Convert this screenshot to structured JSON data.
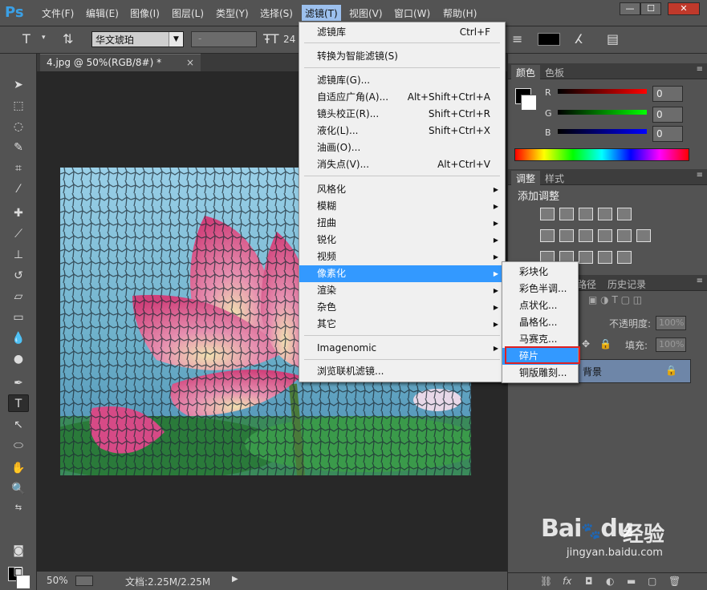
{
  "app": {
    "logo": "Ps"
  },
  "menubar": {
    "items": [
      "文件(F)",
      "编辑(E)",
      "图像(I)",
      "图层(L)",
      "类型(Y)",
      "选择(S)",
      "滤镜(T)",
      "视图(V)",
      "窗口(W)",
      "帮助(H)"
    ],
    "window_buttons": [
      "—",
      "☐",
      "✕"
    ]
  },
  "options": {
    "font_family": "华文琥珀",
    "font_style": "-",
    "font_size": "24"
  },
  "document": {
    "tab_title": "4.jpg @ 50%(RGB/8#) *",
    "tab_close": "×",
    "zoom": "50%",
    "doc_info": "文档:2.25M/2.25M",
    "status_arrow": "▶"
  },
  "filter_menu": {
    "items": [
      {
        "label": "滤镜库",
        "shortcut": "Ctrl+F"
      },
      {
        "label": "转换为智能滤镜(S)",
        "shortcut": ""
      },
      {
        "label": "滤镜库(G)...",
        "shortcut": ""
      },
      {
        "label": "自适应广角(A)...",
        "shortcut": "Alt+Shift+Ctrl+A"
      },
      {
        "label": "镜头校正(R)...",
        "shortcut": "Shift+Ctrl+R"
      },
      {
        "label": "液化(L)...",
        "shortcut": "Shift+Ctrl+X"
      },
      {
        "label": "油画(O)...",
        "shortcut": ""
      },
      {
        "label": "消失点(V)...",
        "shortcut": "Alt+Ctrl+V"
      },
      {
        "label": "风格化",
        "shortcut": ""
      },
      {
        "label": "模糊",
        "shortcut": ""
      },
      {
        "label": "扭曲",
        "shortcut": ""
      },
      {
        "label": "锐化",
        "shortcut": ""
      },
      {
        "label": "视频",
        "shortcut": ""
      },
      {
        "label": "像素化",
        "shortcut": ""
      },
      {
        "label": "渲染",
        "shortcut": ""
      },
      {
        "label": "杂色",
        "shortcut": ""
      },
      {
        "label": "其它",
        "shortcut": ""
      },
      {
        "label": "Imagenomic",
        "shortcut": ""
      },
      {
        "label": "浏览联机滤镜...",
        "shortcut": ""
      }
    ]
  },
  "pixelate_submenu": {
    "items": [
      "彩块化",
      "彩色半调...",
      "点状化...",
      "晶格化...",
      "马赛克...",
      "碎片",
      "铜版雕刻..."
    ]
  },
  "panels": {
    "color_tabs": [
      "颜色",
      "色板"
    ],
    "rgb": [
      {
        "label": "R",
        "value": "0"
      },
      {
        "label": "G",
        "value": "0"
      },
      {
        "label": "B",
        "value": "0"
      }
    ],
    "adjust_tabs": [
      "调整",
      "样式"
    ],
    "adjust_title": "添加调整",
    "layer_tabs": [
      "路径",
      "历史记录"
    ],
    "opacity_label": "不透明度:",
    "opacity_value": "100%",
    "fill_label": "填充:",
    "fill_value": "100%",
    "layer_name": "背景",
    "lock_icon": "🔒",
    "fx_label": "fx"
  },
  "watermark": {
    "brand": "Bai",
    "brand2": "du",
    "cn": "经验",
    "url": "jingyan.baidu.com"
  },
  "colors": {
    "highlight": "#3399ff",
    "red_box": "#e02020"
  }
}
